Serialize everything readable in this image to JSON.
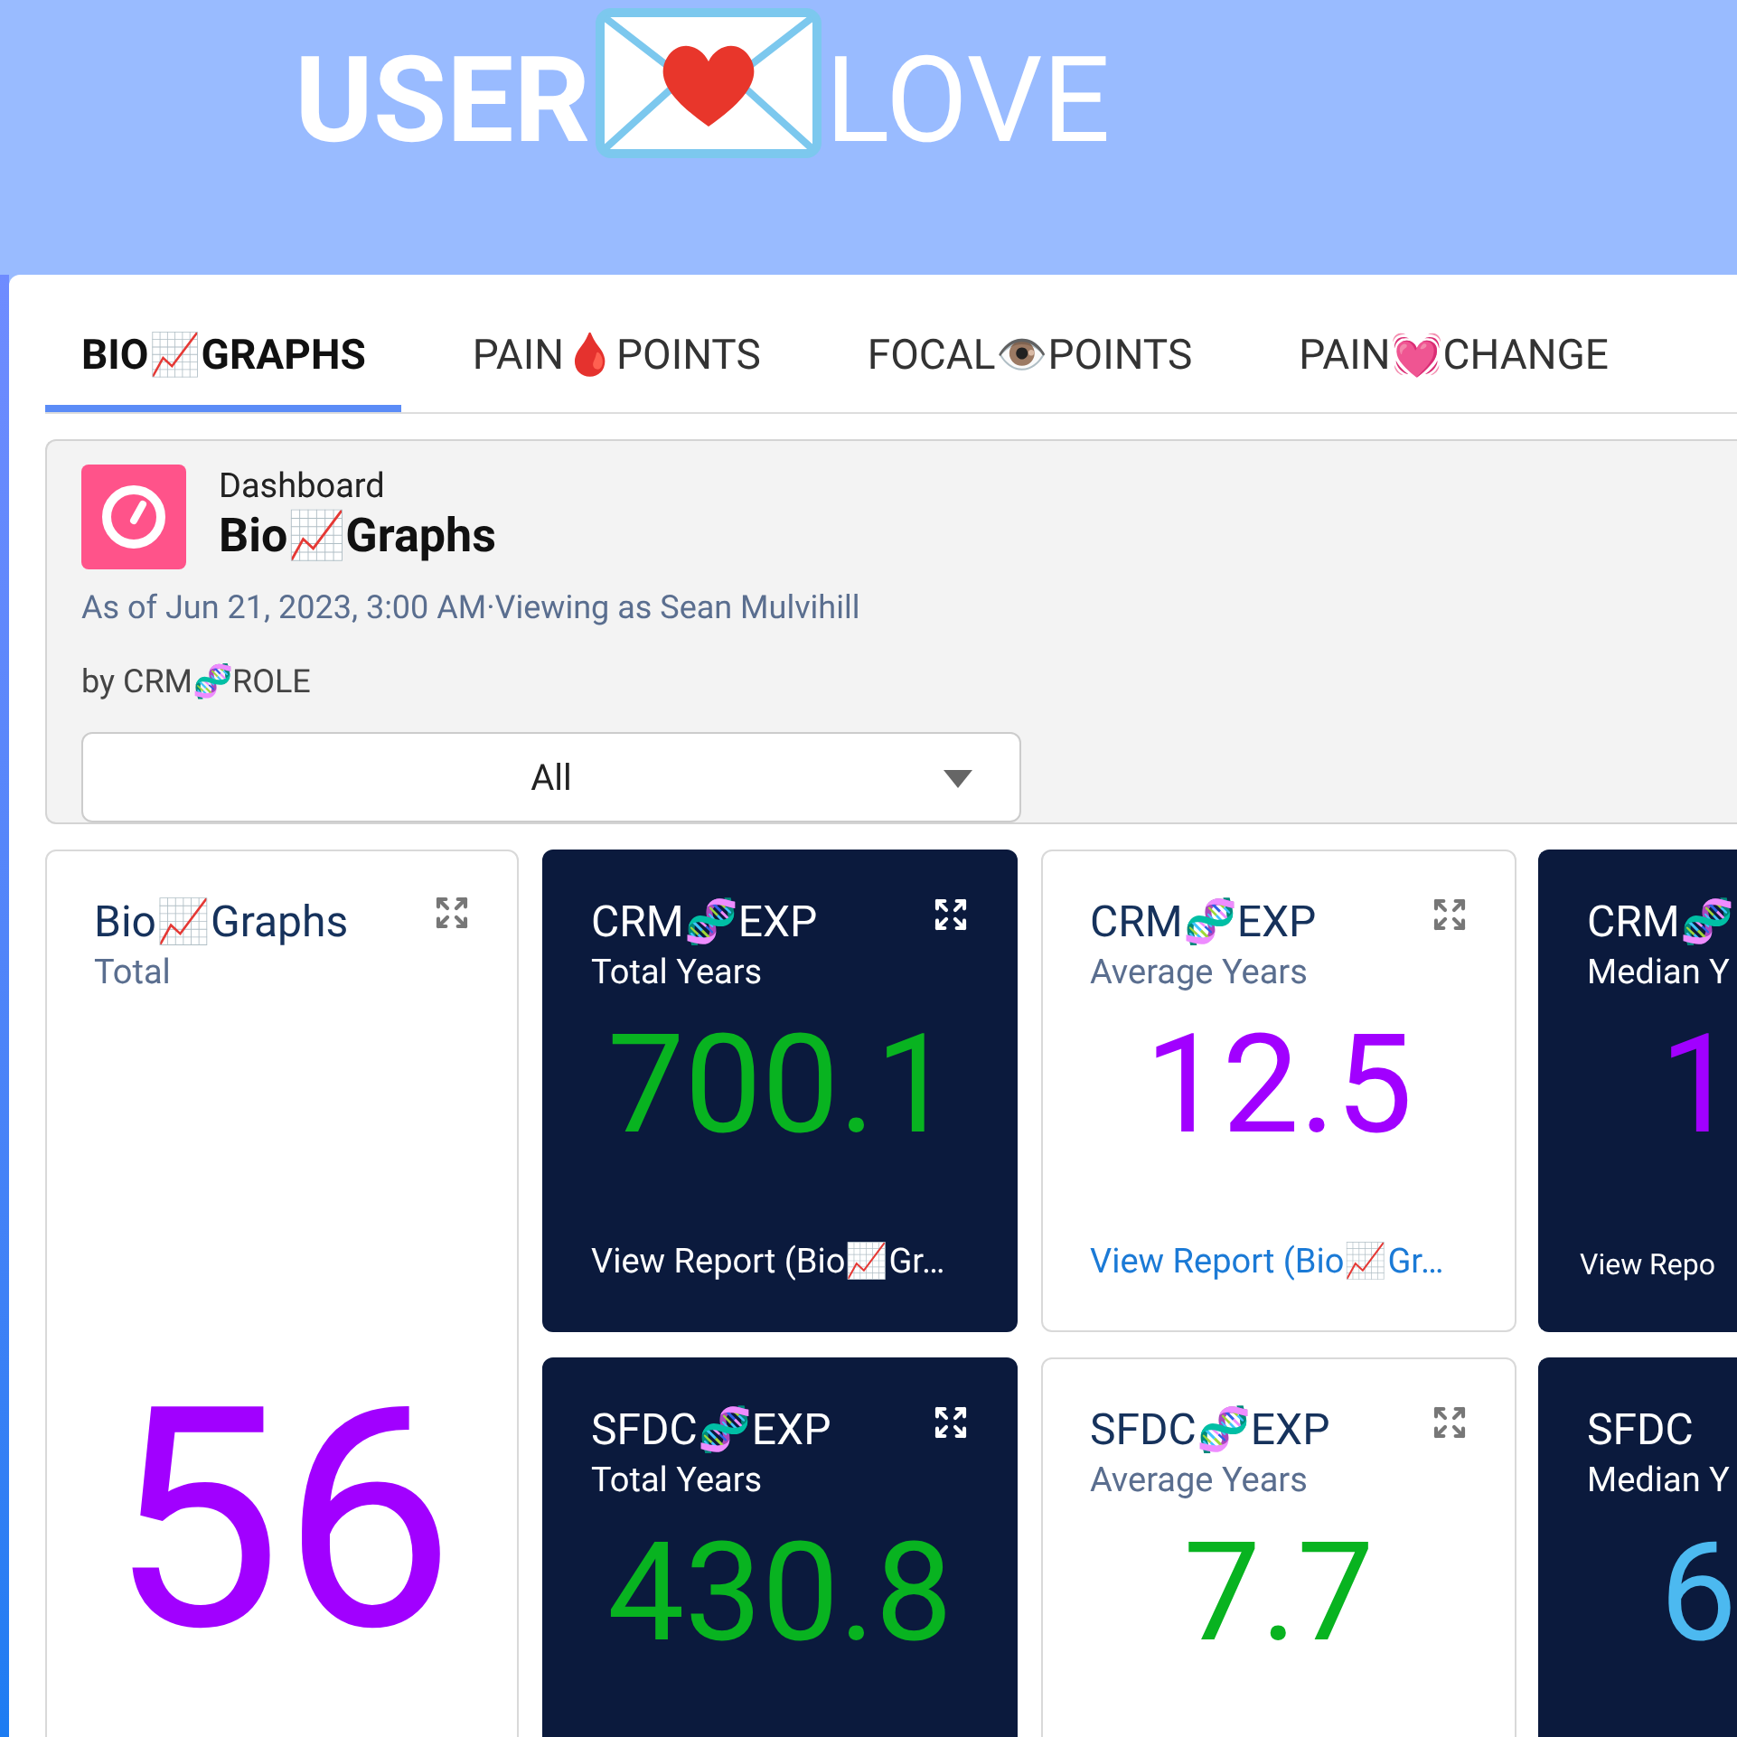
{
  "brand": {
    "left": "USER",
    "right": "LOVE"
  },
  "tabs": [
    {
      "label": "BIO📈GRAPHS",
      "selected": true
    },
    {
      "label": "PAIN🩸POINTS",
      "selected": false
    },
    {
      "label": "FOCAL👁️POINTS",
      "selected": false
    },
    {
      "label": "PAIN💓CHANGE",
      "selected": false
    }
  ],
  "header": {
    "kicker": "Dashboard",
    "title": "Bio📈Graphs",
    "meta": "As of Jun 21, 2023, 3:00 AM·Viewing as Sean Mulvihill",
    "by": "by CRM🧬ROLE",
    "filter": {
      "value": "All"
    }
  },
  "summary_card": {
    "title": "Bio📈Graphs",
    "subtitle": "Total",
    "value": "56",
    "color": "#a100ff"
  },
  "cards": [
    {
      "kind": "dark",
      "title": "CRM🧬EXP",
      "subtitle": "Total Years",
      "value": "700.1",
      "color": "#08b320",
      "link": "View Report (Bio📈Gr…"
    },
    {
      "kind": "light",
      "title": "CRM🧬EXP",
      "subtitle": "Average Years",
      "value": "12.5",
      "color": "#a100ff",
      "link": "View Report (Bio📈Gr…"
    },
    {
      "kind": "partial",
      "title": "CRM🧬",
      "subtitle": "Median Y",
      "value": "1",
      "color": "#a100ff",
      "link": "View Repo"
    },
    {
      "kind": "dark",
      "title": "SFDC🧬EXP",
      "subtitle": "Total Years",
      "value": "430.8",
      "color": "#08b320"
    },
    {
      "kind": "light",
      "title": "SFDC🧬EXP",
      "subtitle": "Average Years",
      "value": "7.7",
      "color": "#08b320"
    },
    {
      "kind": "partial",
      "title": "SFDC",
      "subtitle": "Median Y",
      "value": "6",
      "color": "#4cb9f0"
    }
  ]
}
